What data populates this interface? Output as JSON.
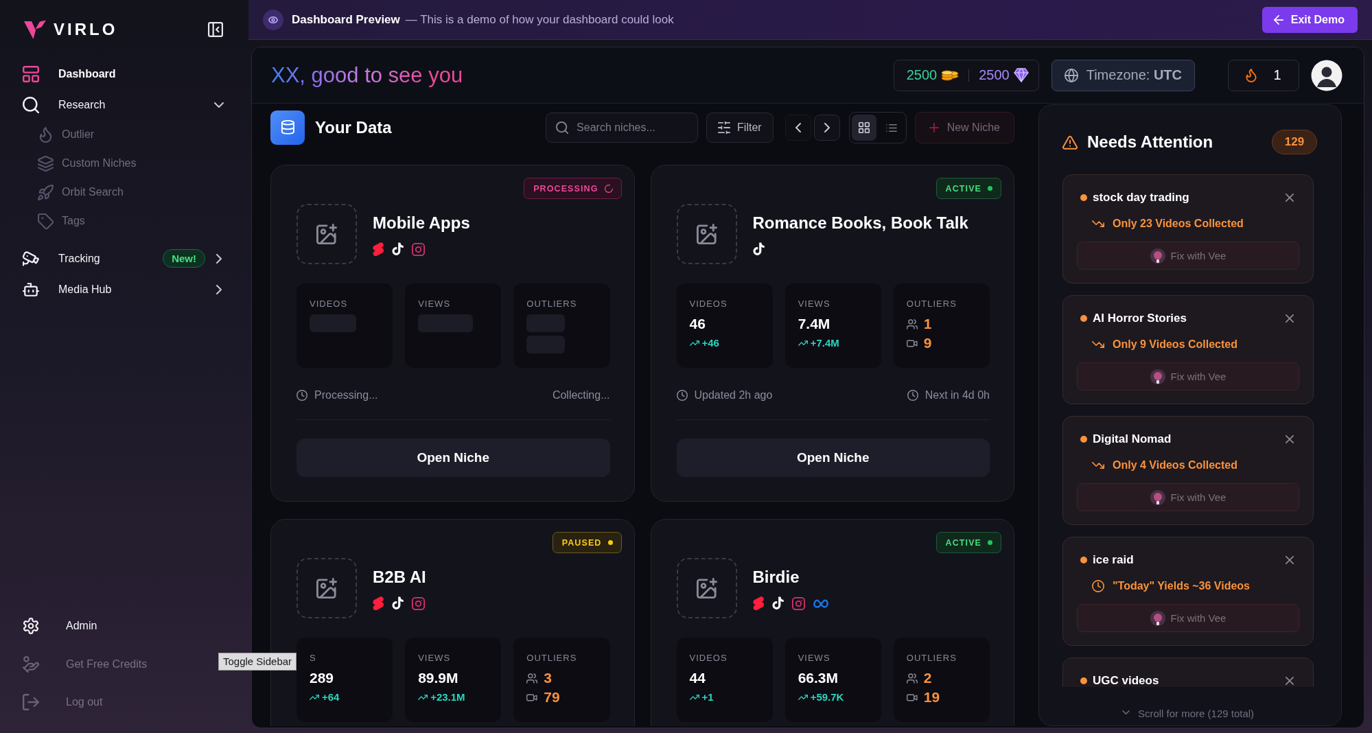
{
  "banner": {
    "title": "Dashboard Preview",
    "message": "— This is a demo of how your dashboard could look",
    "exit_button": "Exit Demo"
  },
  "sidebar": {
    "logo": "VIRLO",
    "nav": [
      {
        "label": "Dashboard",
        "selected": true
      },
      {
        "label": "Research",
        "selected": false,
        "expanded": true,
        "children": [
          {
            "label": "Outlier",
            "selected": false
          },
          {
            "label": "Custom Niches",
            "selected": false
          },
          {
            "label": "Orbit Search",
            "selected": false
          },
          {
            "label": "Tags",
            "selected": false
          }
        ]
      },
      {
        "label": "Tracking",
        "selected": false,
        "expanded": false,
        "badge": "New!"
      },
      {
        "label": "Media Hub",
        "selected": false,
        "expanded": false
      }
    ],
    "footer": [
      {
        "label": "Admin",
        "muted": false
      },
      {
        "label": "Get Free Credits",
        "muted": true
      },
      {
        "label": "Log out",
        "muted": true
      }
    ]
  },
  "tooltip": "Toggle Sidebar",
  "header": {
    "greeting": "XX, good to see you",
    "coins": "2500",
    "gems": "2500",
    "timezone": "Timezone: **UTC**",
    "streak": "1"
  },
  "data_section": {
    "title": "Your Data",
    "search": {
      "placeholder": "Search niches..."
    },
    "filter_button": "Filter",
    "pager": [
      {
        "kind": "prev",
        "disabled": true
      },
      {
        "kind": "next",
        "disabled": false
      }
    ],
    "views": [
      {
        "kind": "grid",
        "selected": true
      },
      {
        "kind": "list",
        "selected": false
      }
    ],
    "new_button": {
      "label": "New Niche",
      "disabled": true
    },
    "niches": [
      {
        "title": "Mobile Apps",
        "status": {
          "kind": "processing",
          "label": "PROCESSING"
        },
        "platforms": [
          {
            "kind": "shorts"
          },
          {
            "kind": "tiktok"
          },
          {
            "kind": "instagram"
          }
        ],
        "loading": true,
        "stats": [
          {
            "kind": "count",
            "label": "VIDEOS"
          },
          {
            "kind": "count",
            "label": "VIEWS"
          },
          {
            "kind": "outliers",
            "label": "OUTLIERS"
          }
        ],
        "updated": "Processing...",
        "next": "Collecting...",
        "open_button": "Open Niche"
      },
      {
        "title": "Romance Books, Book Talk",
        "status": {
          "kind": "active",
          "label": "ACTIVE"
        },
        "platforms": [
          {
            "kind": "tiktok"
          }
        ],
        "loading": false,
        "stats": [
          {
            "kind": "count",
            "label": "VIDEOS",
            "value": "46",
            "delta": "+46"
          },
          {
            "kind": "count",
            "label": "VIEWS",
            "value": "7.4M",
            "delta": "+7.4M"
          },
          {
            "kind": "outliers",
            "label": "OUTLIERS",
            "channels": "1",
            "videos": "9"
          }
        ],
        "updated": "Updated 2h ago",
        "next": "Next in 4d 0h",
        "open_button": "Open Niche"
      },
      {
        "title": "B2B AI",
        "status": {
          "kind": "paused",
          "label": "PAUSED"
        },
        "platforms": [
          {
            "kind": "shorts"
          },
          {
            "kind": "tiktok"
          },
          {
            "kind": "instagram"
          }
        ],
        "loading": false,
        "stats": [
          {
            "kind": "count",
            "label": "S",
            "value": "289",
            "delta": "+64"
          },
          {
            "kind": "count",
            "label": "VIEWS",
            "value": "89.9M",
            "delta": "+23.1M"
          },
          {
            "kind": "outliers",
            "label": "OUTLIERS",
            "channels": "3",
            "videos": "79"
          }
        ]
      },
      {
        "title": "Birdie",
        "status": {
          "kind": "active",
          "label": "ACTIVE"
        },
        "platforms": [
          {
            "kind": "shorts"
          },
          {
            "kind": "tiktok"
          },
          {
            "kind": "instagram"
          },
          {
            "kind": "meta"
          }
        ],
        "loading": false,
        "stats": [
          {
            "kind": "count",
            "label": "VIDEOS",
            "value": "44",
            "delta": "+1"
          },
          {
            "kind": "count",
            "label": "VIEWS",
            "value": "66.3M",
            "delta": "+59.7K"
          },
          {
            "kind": "outliers",
            "label": "OUTLIERS",
            "channels": "2",
            "videos": "19"
          }
        ]
      }
    ]
  },
  "attention": {
    "title": "Needs Attention",
    "count": "129",
    "items": [
      {
        "name": "stock day trading",
        "kind": "shortfall",
        "issue": "Only 23 Videos Collected",
        "fix_button": "Fix with Vee"
      },
      {
        "name": "AI Horror Stories",
        "kind": "shortfall",
        "issue": "Only 9 Videos Collected",
        "fix_button": "Fix with Vee"
      },
      {
        "name": "Digital Nomad",
        "kind": "shortfall",
        "issue": "Only 4 Videos Collected",
        "fix_button": "Fix with Vee"
      },
      {
        "name": "ice raid",
        "kind": "estimate",
        "issue": "\"Today\" Yields ~36 Videos",
        "fix_button": "Fix with Vee"
      },
      {
        "name": "UGC videos"
      }
    ],
    "more": "Scroll for more (129 total)"
  }
}
